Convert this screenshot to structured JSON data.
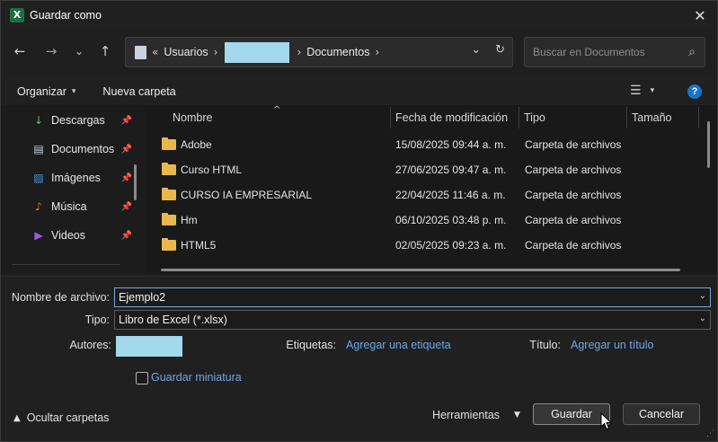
{
  "window": {
    "title": "Guardar como",
    "app_icon_letter": "X",
    "close_glyph": "✕"
  },
  "nav": {
    "back_glyph": "←",
    "forward_glyph": "→",
    "recent_glyph": "⌄",
    "up_glyph": "↑",
    "breadcrumb_overflow": "«",
    "breadcrumb": [
      "Usuarios",
      "Documentos"
    ],
    "chevron": "›",
    "address_dropdown_glyph": "⌄",
    "refresh_glyph": "↻",
    "search_placeholder": "Buscar en Documentos",
    "search_glyph": "⌕"
  },
  "commands": {
    "organize": "Organizar",
    "new_folder": "Nueva carpeta",
    "view_glyph": "☰",
    "caret": "▾",
    "help_glyph": "?"
  },
  "sidebar": {
    "items": [
      {
        "label": "Descargas",
        "icon": "↓",
        "icon_name": "download-icon",
        "color": "#4cc27a"
      },
      {
        "label": "Documentos",
        "icon": "▤",
        "icon_name": "document-icon",
        "color": "#c9d3de"
      },
      {
        "label": "Imágenes",
        "icon": "▨",
        "icon_name": "image-icon",
        "color": "#3d9ae8"
      },
      {
        "label": "Música",
        "icon": "♪",
        "icon_name": "music-icon",
        "color": "#e86f4c"
      },
      {
        "label": "Videos",
        "icon": "▶",
        "icon_name": "video-icon",
        "color": "#9b5de5"
      }
    ],
    "pin_glyph": "📌"
  },
  "files": {
    "columns": [
      "Nombre",
      "Fecha de modificación",
      "Tipo",
      "Tamaño"
    ],
    "sort_glyph": "^",
    "rows": [
      {
        "name": "Adobe",
        "date": "15/08/2025 09:44 a. m.",
        "type": "Carpeta de archivos"
      },
      {
        "name": "Curso HTML",
        "date": "27/06/2025 09:47 a. m.",
        "type": "Carpeta de archivos"
      },
      {
        "name": "CURSO IA EMPRESARIAL",
        "date": "22/04/2025 11:46 a. m.",
        "type": "Carpeta de archivos"
      },
      {
        "name": "Hm",
        "date": "06/10/2025 03:48 p. m.",
        "type": "Carpeta de archivos"
      },
      {
        "name": "HTML5",
        "date": "02/05/2025 09:23 a. m.",
        "type": "Carpeta de archivos"
      }
    ]
  },
  "form": {
    "filename_label": "Nombre de archivo:",
    "filename_value": "Ejemplo2",
    "type_label": "Tipo:",
    "type_value": "Libro de Excel (*.xlsx)",
    "authors_label": "Autores:",
    "tags_label": "Etiquetas:",
    "tags_link": "Agregar una etiqueta",
    "title_label": "Título:",
    "title_link": "Agregar un título",
    "thumbnail_label": "Guardar miniatura",
    "dropdown_glyph": "⌄"
  },
  "footer": {
    "hide_folders": "Ocultar carpetas",
    "hide_glyph": "▲",
    "tools": "Herramientas",
    "tools_caret": "▼",
    "save": "Guardar",
    "cancel": "Cancelar",
    "grip_glyph": "⋰"
  }
}
